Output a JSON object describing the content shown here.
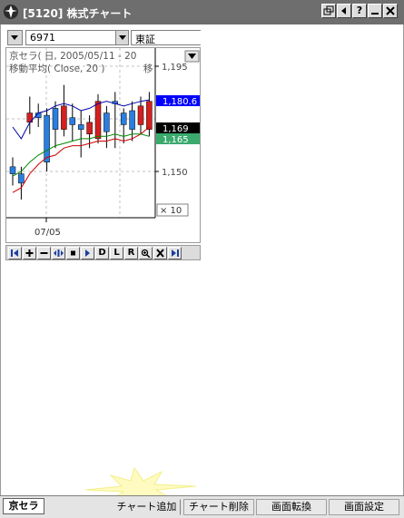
{
  "window": {
    "title": "[5120] 株式チャート",
    "buttons": [
      "restore-icon",
      "back-icon",
      "help-icon",
      "minimize-icon",
      "close-icon"
    ]
  },
  "controls": {
    "code_value": "6971",
    "market_value": "東証"
  },
  "chart": {
    "header_line1": "京セラ( 日, 2005/05/11 - 20",
    "header_line2": "移動平均( Close, 20 )",
    "header_line2_right": "移",
    "price_labels": [
      "1,195",
      "1,180.6",
      "1,169",
      "1,150"
    ],
    "highlight_labels": {
      "blue": "1,180.6",
      "black": "1,169",
      "green": "1,165"
    },
    "zoom_label": "× 10",
    "x_tick": "07/05",
    "colors": {
      "up": "#d42020",
      "down": "#2a7ee0",
      "ma_short": "#0000aa",
      "ma_long": "#cc0000",
      "ma_mid": "#008800",
      "blue_label": "#0000ff",
      "black_label": "#000000",
      "green_label": "#3aaa6e"
    }
  },
  "chart_data": {
    "type": "candlestick",
    "title": "京セラ( 日, 2005/05/11 - 20",
    "ylim": [
      1138,
      1200
    ],
    "y_ticks": [
      1195,
      1150
    ],
    "x_tick_labels": [
      "07/05"
    ],
    "candles": [
      {
        "o": 1152,
        "c": 1149,
        "h": 1156,
        "l": 1144
      },
      {
        "o": 1149,
        "c": 1145,
        "h": 1152,
        "l": 1138
      },
      {
        "o": 1171,
        "c": 1175,
        "h": 1182,
        "l": 1166
      },
      {
        "o": 1175,
        "c": 1173,
        "h": 1179,
        "l": 1169
      },
      {
        "o": 1174,
        "c": 1154,
        "h": 1177,
        "l": 1150
      },
      {
        "o": 1177,
        "c": 1168,
        "h": 1180,
        "l": 1160
      },
      {
        "o": 1168,
        "c": 1178,
        "h": 1187,
        "l": 1165
      },
      {
        "o": 1173,
        "c": 1170,
        "h": 1179,
        "l": 1163
      },
      {
        "o": 1170,
        "c": 1168,
        "h": 1176,
        "l": 1156
      },
      {
        "o": 1166,
        "c": 1171,
        "h": 1174,
        "l": 1160
      },
      {
        "o": 1164,
        "c": 1180,
        "h": 1183,
        "l": 1162
      },
      {
        "o": 1175,
        "c": 1167,
        "h": 1178,
        "l": 1160
      },
      {
        "o": 1180,
        "c": 1179,
        "h": 1184,
        "l": 1160
      },
      {
        "o": 1175,
        "c": 1170,
        "h": 1177,
        "l": 1162
      },
      {
        "o": 1176,
        "c": 1168,
        "h": 1180,
        "l": 1163
      },
      {
        "o": 1170,
        "c": 1178,
        "h": 1182,
        "l": 1166
      },
      {
        "o": 1168,
        "c": 1180,
        "h": 1184,
        "l": 1165
      }
    ],
    "series": [
      {
        "values": [
          1169,
          1164,
          1171,
          1175,
          1176,
          1178,
          1179,
          1178,
          1176,
          1177,
          1179,
          1180,
          1179,
          1178,
          1179,
          1180,
          1180.6
        ]
      },
      {
        "values": [
          1141,
          1143,
          1149,
          1153,
          1156,
          1157,
          1160,
          1161,
          1161,
          1162,
          1163,
          1163,
          1164,
          1163,
          1164,
          1166,
          1169
        ]
      },
      {
        "values": [
          1148,
          1150,
          1154,
          1157,
          1159,
          1161,
          1162,
          1163,
          1164,
          1164,
          1165,
          1165,
          1166,
          1165,
          1166,
          1166,
          1165
        ]
      }
    ]
  },
  "toolbar": [
    "first-icon",
    "plus-icon",
    "minus-icon",
    "pan-icon",
    "stop-icon",
    "next-icon",
    "D",
    "L",
    "R",
    "zoom-icon",
    "delete-icon",
    "last-icon"
  ],
  "bottom": {
    "sheet_tab": "京セラ",
    "add_chart": "チャート追加",
    "delete_chart": "チャート削除",
    "screen_convert": "画面転換",
    "screen_settings": "画面設定"
  }
}
